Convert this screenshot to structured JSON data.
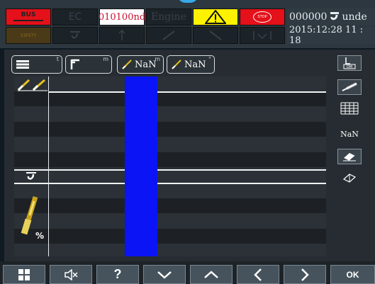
{
  "top_bar": {
    "bus_label": "BUS",
    "ec_label": "EC",
    "code_value": "010100nd",
    "engine_label": "Engine",
    "warning_icon": "warning-triangle-icon",
    "stop_label": "STOP",
    "counter_value": "000000",
    "counter_suffix": "unde",
    "datetime": "2015:12:28  11 : 18",
    "row2_left_label": "S3FETY"
  },
  "toolbar": {
    "load_button": {
      "icon": "list-icon",
      "unit": "t"
    },
    "radius_button": {
      "icon": "crane-hook-icon",
      "unit": "m"
    },
    "boom_length_button": {
      "icon": "boom-icon",
      "value": "NaN",
      "unit": "m"
    },
    "angle_button": {
      "icon": "boom-angle-icon",
      "value": "NaN",
      "unit": "°"
    }
  },
  "sidebar": {
    "nan_value": "NaN",
    "buttons": [
      "om-icon",
      "telescopic-boom-icon",
      "chart-grid-icon",
      "eraser-icon",
      "eraser-icon"
    ]
  },
  "left_panel": {
    "percent_label": "%"
  },
  "nav": {
    "ok_label": "OK",
    "help_label": "?"
  },
  "colors": {
    "bus": "#e4101a",
    "warning": "#fff200",
    "stop": "#e4101a",
    "load_bar": "#0a14f5"
  }
}
